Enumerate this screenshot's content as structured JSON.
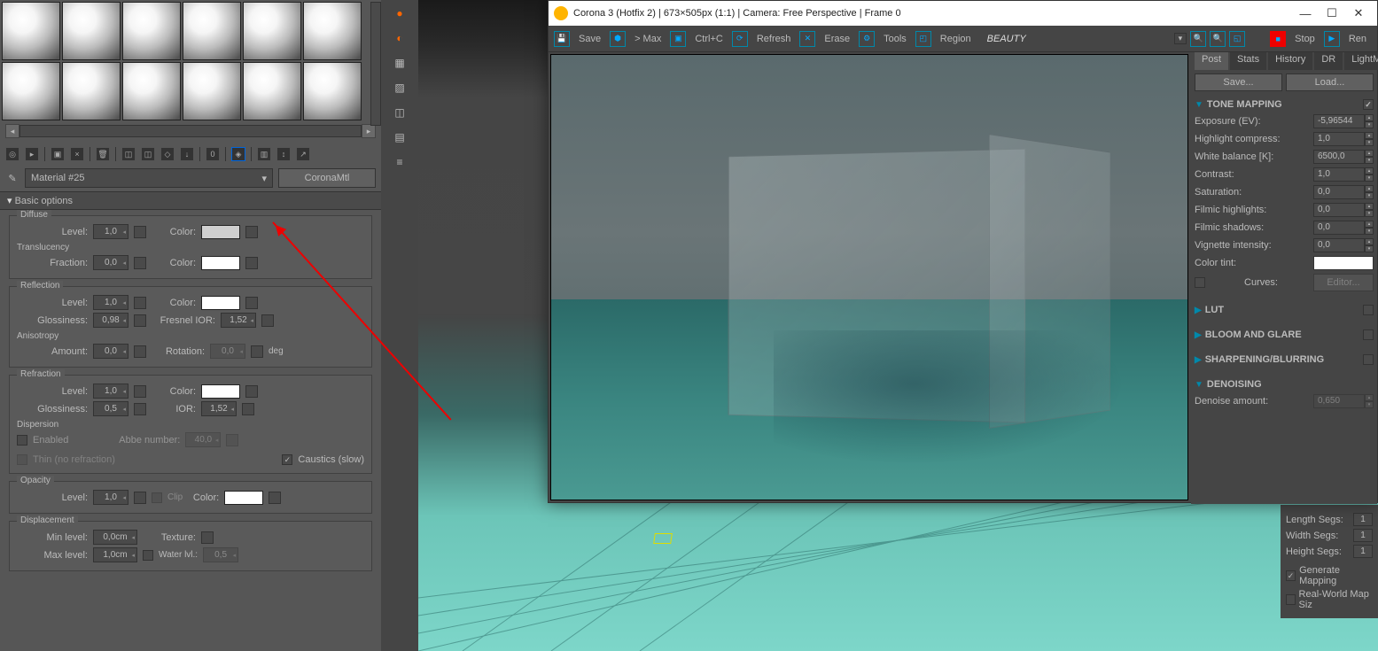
{
  "window": {
    "title": "Corona 3 (Hotfix 2) | 673×505px (1:1) | Camera: Free Perspective | Frame 0"
  },
  "vfb_toolbar": {
    "save": "Save",
    "max": "> Max",
    "ctrlc": "Ctrl+C",
    "refresh": "Refresh",
    "erase": "Erase",
    "tools": "Tools",
    "region": "Region",
    "pass": "BEAUTY",
    "stop": "Stop",
    "render": "Ren"
  },
  "tabs": [
    "Post",
    "Stats",
    "History",
    "DR",
    "LightM"
  ],
  "active_tab": "Post",
  "buttons": {
    "save": "Save...",
    "load": "Load..."
  },
  "tone_mapping": {
    "header": "TONE MAPPING",
    "exposure_label": "Exposure (EV):",
    "exposure": "-5,96544",
    "highlight_label": "Highlight compress:",
    "highlight": "1,0",
    "white_bal_label": "White balance [K]:",
    "white_bal": "6500,0",
    "contrast_label": "Contrast:",
    "contrast": "1,0",
    "saturation_label": "Saturation:",
    "saturation": "0,0",
    "filmic_h_label": "Filmic highlights:",
    "filmic_h": "0,0",
    "filmic_s_label": "Filmic shadows:",
    "filmic_s": "0,0",
    "vignette_label": "Vignette intensity:",
    "vignette": "0,0",
    "tint_label": "Color tint:",
    "curves_label": "Curves:",
    "editor": "Editor..."
  },
  "sections": {
    "lut": "LUT",
    "bloom": "BLOOM AND GLARE",
    "sharpen": "SHARPENING/BLURRING",
    "denoise": "DENOISING",
    "denoise_label": "Denoise amount:",
    "denoise_val": "0,650"
  },
  "segs": {
    "length_label": "Length Segs:",
    "length": "1",
    "width_label": "Width Segs:",
    "width": "1",
    "height_label": "Height Segs:",
    "height": "1",
    "gen_map": "Generate Mapping",
    "real_world": "Real-World Map Siz"
  },
  "material": {
    "name": "Material #25",
    "type": "CoronaMtl",
    "header": "Basic options"
  },
  "diffuse": {
    "title": "Diffuse",
    "level_label": "Level:",
    "level": "1,0",
    "color_label": "Color:",
    "trans_title": "Translucency",
    "fraction_label": "Fraction:",
    "fraction": "0,0"
  },
  "reflection": {
    "title": "Reflection",
    "level_label": "Level:",
    "level": "1,0",
    "color_label": "Color:",
    "gloss_label": "Glossiness:",
    "gloss": "0,98",
    "ior_label": "Fresnel IOR:",
    "ior": "1,52",
    "aniso_title": "Anisotropy",
    "amount_label": "Amount:",
    "amount": "0,0",
    "rotation_label": "Rotation:",
    "rotation": "0,0",
    "deg": "deg"
  },
  "refraction": {
    "title": "Refraction",
    "level_label": "Level:",
    "level": "1,0",
    "color_label": "Color:",
    "gloss_label": "Glossiness:",
    "gloss": "0,5",
    "ior_label": "IOR:",
    "ior": "1,52",
    "disp_title": "Dispersion",
    "enabled": "Enabled",
    "abbe_label": "Abbe number:",
    "abbe": "40,0",
    "thin": "Thin (no refraction)",
    "caustics": "Caustics (slow)"
  },
  "opacity": {
    "title": "Opacity",
    "level_label": "Level:",
    "level": "1,0",
    "clip": "Clip",
    "color_label": "Color:"
  },
  "displacement": {
    "title": "Displacement",
    "min_label": "Min level:",
    "min": "0,0cm",
    "tex_label": "Texture:",
    "max_label": "Max level:",
    "max": "1,0cm",
    "water_label": "Water lvl.:",
    "water": "0,5"
  }
}
